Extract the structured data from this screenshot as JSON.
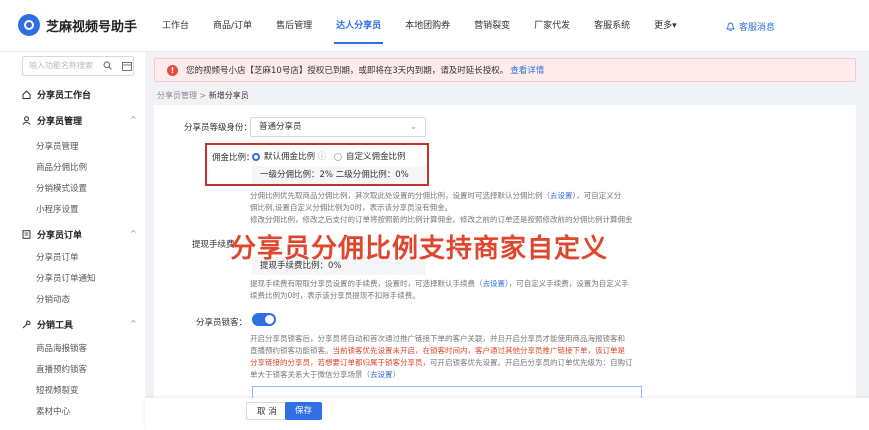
{
  "app": {
    "title": "芝麻视频号助手"
  },
  "nav": {
    "items": [
      "工作台",
      "商品/订单",
      "售后管理",
      "达人分享员",
      "本地团购券",
      "营销裂变",
      "厂家代发",
      "客服系统",
      "更多▾"
    ],
    "service": "客服消息"
  },
  "sidebar": {
    "search_placeholder": "输入功能名称搜索",
    "workbench": "分享员工作台",
    "sections": [
      {
        "title": "分享员管理",
        "items": [
          "分享员管理",
          "商品分佣比例",
          "分销模式设置",
          "小程序设置"
        ]
      },
      {
        "title": "分享员订单",
        "items": [
          "分享员订单",
          "分享员订单通知",
          "分销动态"
        ]
      },
      {
        "title": "分销工具",
        "items": [
          "商品海报锁客",
          "直播预约锁客",
          "短视频裂变",
          "素材中心"
        ]
      }
    ]
  },
  "alert": {
    "text": "您的视频号小店【芝麻10号店】授权已到期，或即将在3天内到期，请及时延长授权。",
    "link": "查看详情"
  },
  "breadcrumb": {
    "parent": "分享员管理",
    "sep": ">",
    "current": "新增分享员"
  },
  "form": {
    "level_label": "分享员等级身份",
    "level_value": "普通分享员",
    "commission_label": "佣金比例",
    "commission_default": "默认佣金比例",
    "commission_custom": "自定义佣金比例",
    "commission_values": "一级分佣比例：2%   二级分佣比例：0%",
    "commission_desc_1": "分佣比例优先取商品分佣比例，其次取此处设置的分佣比例，设置时可选择默认分佣比例（",
    "commission_desc_link": "去设置",
    "commission_desc_2": "），可自定义分",
    "commission_desc_3": "佣比例,设置自定义分佣比例为0时，表示该分享员没有佣金。",
    "commission_desc_4": "修改分佣比例，修改之后支付的订单将按照新的比例计算佣金。修改之前的订单还是按照修改前的分佣比例计算佣金",
    "fee_label": "提现手续费",
    "fee_value": "提现手续费比例：0%",
    "fee_desc_1": "提现手续费有限取分享员设置的手续费，设置时，可选择默认手续费（",
    "fee_desc_link": "去设置",
    "fee_desc_2": "），可自定义手续费，设置为自定义手",
    "fee_desc_3": "续费比例为0时，表示该分享员提现不扣除手续费。",
    "lock_label": "分享员锁客",
    "lock_desc_1": "开启分享员锁客后，分享员将自动和首次通过推广链接下单的客户关联，并且开启分享员才能使用商品海报锁客和",
    "lock_desc_2": "直播预约锁客功能锁客。",
    "lock_desc_red": "当前锁客优先设置未开启，在锁客时间内，客户通过其他分享员推广链接下单，该订单是",
    "lock_desc_red2": "分享链接的分享员，若想要订单都归属于锁客分享员，",
    "lock_desc_3": "可开启锁客优先设置。开启后分享员的订单优先级为：自购订",
    "lock_desc_4": "单大于锁客关系大于微信分享场景（",
    "lock_desc_link": "去设置",
    "lock_desc_5": "）"
  },
  "overlay_text": "分享员分佣比例支持商家自定义",
  "buttons": {
    "cancel": "取 消",
    "save": "保存"
  }
}
